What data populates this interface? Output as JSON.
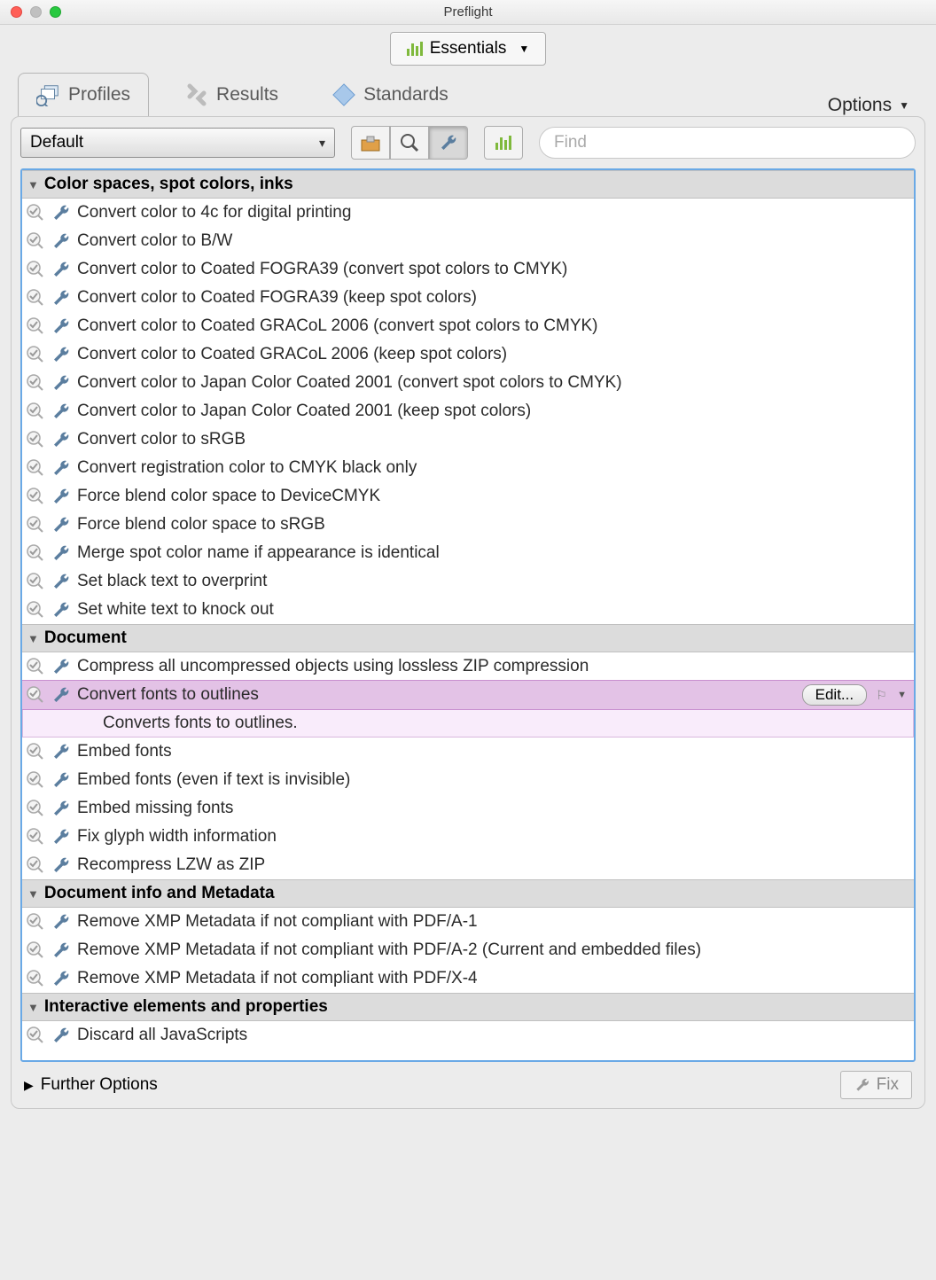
{
  "window": {
    "title": "Preflight"
  },
  "essentials": {
    "label": "Essentials"
  },
  "tabs": {
    "profiles": "Profiles",
    "results": "Results",
    "standards": "Standards"
  },
  "options_label": "Options",
  "dropdown_selected": "Default",
  "search": {
    "placeholder": "Find"
  },
  "groups": [
    {
      "title": "Color spaces, spot colors, inks",
      "items": [
        {
          "label": "Convert color to 4c for digital printing"
        },
        {
          "label": "Convert color to B/W"
        },
        {
          "label": "Convert color to Coated FOGRA39 (convert spot colors to CMYK)"
        },
        {
          "label": "Convert color to Coated FOGRA39 (keep spot colors)"
        },
        {
          "label": "Convert color to Coated GRACoL 2006 (convert spot colors to CMYK)"
        },
        {
          "label": "Convert color to Coated GRACoL 2006 (keep spot colors)"
        },
        {
          "label": "Convert color to Japan Color Coated 2001 (convert spot colors to CMYK)"
        },
        {
          "label": "Convert color to Japan Color Coated 2001 (keep spot colors)"
        },
        {
          "label": "Convert color to sRGB"
        },
        {
          "label": "Convert registration color to CMYK black only"
        },
        {
          "label": "Force blend color space to DeviceCMYK"
        },
        {
          "label": "Force blend color space to sRGB"
        },
        {
          "label": "Merge spot color name if appearance is identical"
        },
        {
          "label": "Set black text to overprint"
        },
        {
          "label": "Set white text to knock out"
        }
      ]
    },
    {
      "title": "Document",
      "items": [
        {
          "label": "Compress all uncompressed objects using lossless ZIP compression"
        },
        {
          "label": "Convert fonts to outlines",
          "selected": true,
          "edit_label": "Edit...",
          "description": "Converts fonts to outlines."
        },
        {
          "label": "Embed fonts"
        },
        {
          "label": "Embed fonts (even if text is invisible)"
        },
        {
          "label": "Embed missing fonts"
        },
        {
          "label": "Fix glyph width information"
        },
        {
          "label": "Recompress LZW as ZIP"
        }
      ]
    },
    {
      "title": "Document info and Metadata",
      "items": [
        {
          "label": "Remove XMP Metadata if not compliant with PDF/A-1"
        },
        {
          "label": "Remove XMP Metadata if not compliant with PDF/A-2 (Current and embedded files)"
        },
        {
          "label": "Remove XMP Metadata if not compliant with PDF/X-4"
        }
      ]
    },
    {
      "title": "Interactive elements and properties",
      "items": [
        {
          "label": "Discard all JavaScripts"
        }
      ]
    }
  ],
  "further_options": "Further Options",
  "fix_button": "Fix"
}
